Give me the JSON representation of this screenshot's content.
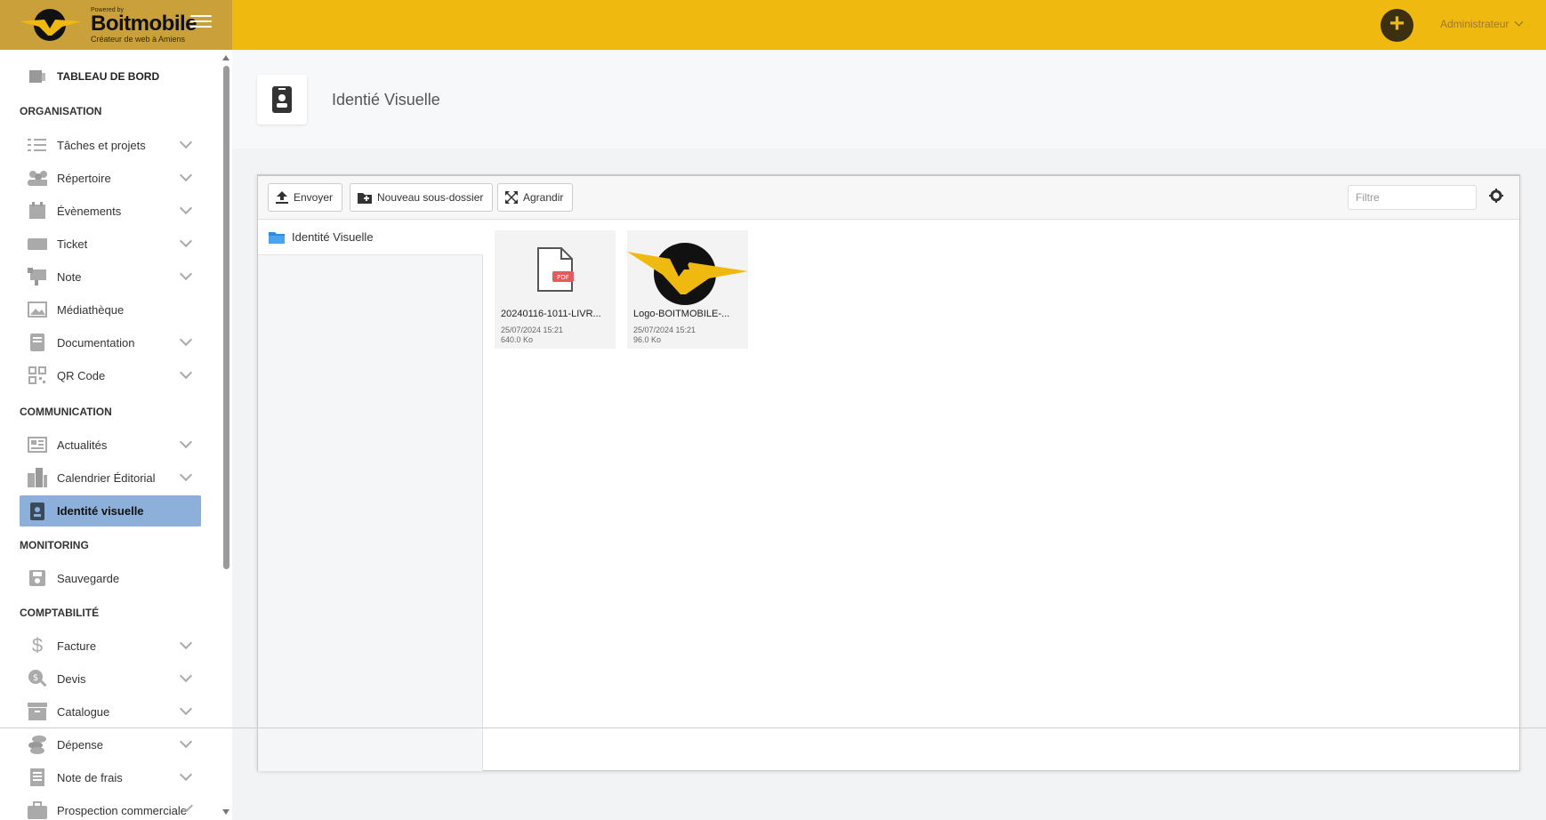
{
  "brand": {
    "powered": "Powered by",
    "name": "Boitmobile",
    "tagline": "Créateur de web à Amiens"
  },
  "topbar": {
    "add_label": "+",
    "user": "Administrateur"
  },
  "sidebar": {
    "dashboard": "TABLEAU DE BORD",
    "sections": {
      "organisation": "ORGANISATION",
      "communication": "COMMUNICATION",
      "monitoring": "MONITORING",
      "comptabilite": "COMPTABILITÉ"
    },
    "items": {
      "taches": "Tâches et projets",
      "repertoire": "Répertoire",
      "evenements": "Évènements",
      "ticket": "Ticket",
      "note": "Note",
      "mediatheque": "Médiathèque",
      "documentation": "Documentation",
      "qrcode": "QR Code",
      "actualites": "Actualités",
      "calendrier": "Calendrier Éditorial",
      "identite": "Identité visuelle",
      "sauvegarde": "Sauvegarde",
      "facture": "Facture",
      "devis": "Devis",
      "catalogue": "Catalogue",
      "depense": "Dépense",
      "notefrais": "Note de frais",
      "prospection": "Prospection commerciale"
    }
  },
  "page": {
    "title": "Identié Visuelle"
  },
  "filemanager": {
    "toolbar": {
      "upload": "Envoyer",
      "new_folder": "Nouveau sous-dossier",
      "expand": "Agrandir",
      "filter_placeholder": "Filtre"
    },
    "tree": {
      "root": "Identité Visuelle"
    },
    "files": [
      {
        "name": "20240116-1011-LIVR...",
        "date": "25/07/2024 15:21",
        "size": "640.0 Ko",
        "type": "pdf"
      },
      {
        "name": "Logo-BOITMOBILE-...",
        "date": "25/07/2024 15:21",
        "size": "96.0 Ko",
        "type": "image"
      }
    ]
  },
  "colors": {
    "topbar": "#f0b910",
    "brand_bg": "#c9a03a",
    "active_item": "#8cb0d9",
    "pdf_badge": "#e55b5b"
  }
}
